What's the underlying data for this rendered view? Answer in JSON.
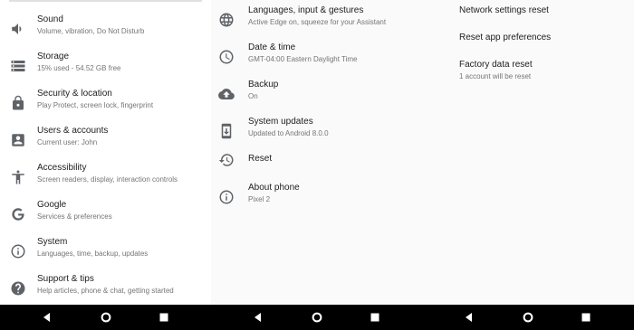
{
  "panel1": {
    "items": [
      {
        "title": "Sound",
        "summary": "Volume, vibration, Do Not Disturb",
        "icon": "volume-icon"
      },
      {
        "title": "Storage",
        "summary": "15% used - 54.52 GB free",
        "icon": "storage-icon"
      },
      {
        "title": "Security & location",
        "summary": "Play Protect, screen lock, fingerprint",
        "icon": "lock-icon"
      },
      {
        "title": "Users & accounts",
        "summary": "Current user: John",
        "icon": "account-icon"
      },
      {
        "title": "Accessibility",
        "summary": "Screen readers, display, interaction controls",
        "icon": "accessibility-icon"
      },
      {
        "title": "Google",
        "summary": "Services & preferences",
        "icon": "google-icon"
      },
      {
        "title": "System",
        "summary": "Languages, time, backup, updates",
        "icon": "info-icon"
      },
      {
        "title": "Support & tips",
        "summary": "Help articles, phone & chat, getting started",
        "icon": "help-icon"
      }
    ]
  },
  "panel2": {
    "items": [
      {
        "title": "Languages, input & gestures",
        "summary": "Active Edge on, squeeze for your Assistant",
        "icon": "globe-icon"
      },
      {
        "title": "Date & time",
        "summary": "GMT-04:00 Eastern Daylight Time",
        "icon": "clock-icon"
      },
      {
        "title": "Backup",
        "summary": "On",
        "icon": "cloud-upload-icon"
      },
      {
        "title": "System updates",
        "summary": "Updated to Android 8.0.0",
        "icon": "system-update-icon"
      },
      {
        "title": "Reset",
        "summary": "",
        "icon": "restore-icon"
      },
      {
        "title": "About phone",
        "summary": "Pixel 2",
        "icon": "info-icon"
      }
    ]
  },
  "panel3": {
    "items": [
      {
        "title": "Network settings reset",
        "summary": ""
      },
      {
        "title": "Reset app preferences",
        "summary": ""
      },
      {
        "title": "Factory data reset",
        "summary": "1 account will be reset"
      }
    ]
  },
  "navbar": {
    "buttons": [
      "back-icon",
      "home-icon",
      "recents-icon"
    ]
  },
  "colors": {
    "title": "#212121",
    "summary": "#757575",
    "icon": "#5f6368",
    "navbar": "#000000"
  }
}
